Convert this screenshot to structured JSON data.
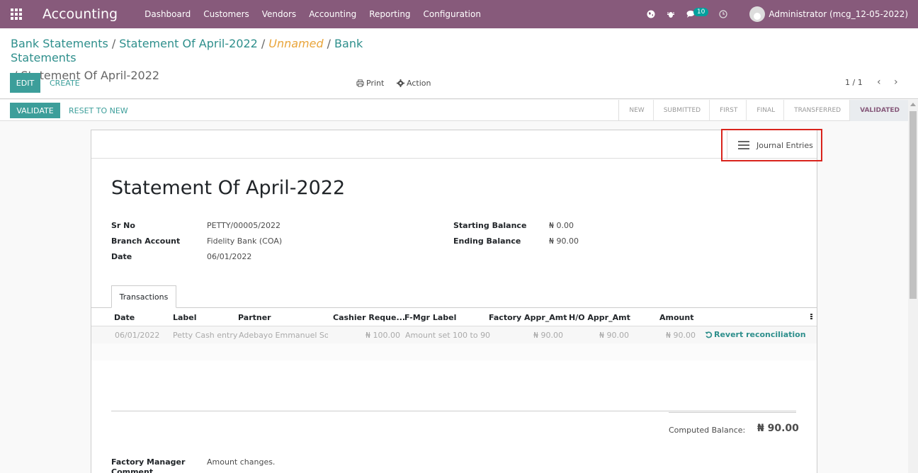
{
  "navbar": {
    "app_name": "Accounting",
    "menu": [
      "Dashboard",
      "Customers",
      "Vendors",
      "Accounting",
      "Reporting",
      "Configuration"
    ],
    "message_count": "10",
    "user": "Administrator (mcg_12-05-2022)"
  },
  "breadcrumb": {
    "items": [
      "Bank Statements",
      "Statement Of April-2022",
      "Unnamed",
      "Bank Statements"
    ],
    "current": "Statement Of April-2022"
  },
  "buttons": {
    "edit": "EDIT",
    "create": "CREATE",
    "print": "Print",
    "action": "Action",
    "validate": "VALIDATE",
    "reset": "RESET TO NEW"
  },
  "pager": "1 / 1",
  "stages": [
    "NEW",
    "SUBMITTED",
    "FIRST",
    "FINAL",
    "TRANSFERRED",
    "VALIDATED"
  ],
  "active_stage": "VALIDATED",
  "smart_button": "Journal Entries",
  "record": {
    "title": "Statement Of April-2022",
    "fields_left": [
      {
        "label": "Sr No",
        "value": "PETTY/00005/2022"
      },
      {
        "label": "Branch Account",
        "value": "Fidelity Bank (COA)"
      },
      {
        "label": "Date",
        "value": "06/01/2022"
      }
    ],
    "fields_right": [
      {
        "label": "Starting Balance",
        "value": "₦ 0.00"
      },
      {
        "label": "Ending Balance",
        "value": "₦ 90.00"
      }
    ]
  },
  "tab": "Transactions",
  "table": {
    "headers": [
      "Date",
      "Label",
      "Partner",
      "Cashier Reque...",
      "F-Mgr Label",
      "Factory Appr_Amt",
      "H/O Appr_Amt",
      "Amount"
    ],
    "row": {
      "date": "06/01/2022",
      "label": "Petty Cash entry",
      "partner": "Adebayo Emmanuel Soji",
      "cashier": "₦ 100.00",
      "fmgr": "Amount set 100 to 90",
      "factory": "₦ 90.00",
      "ho": "₦ 90.00",
      "amount": "₦ 90.00",
      "action": "Revert reconciliation"
    }
  },
  "totals": {
    "computed_label": "Computed Balance:",
    "computed_value": "₦ 90.00"
  },
  "footer": {
    "label": "Factory Manager Comment",
    "value": "Amount changes."
  },
  "colors": {
    "navbar": "#875a7b",
    "primary": "#3c9e9a",
    "highlight": "#d9231c"
  }
}
